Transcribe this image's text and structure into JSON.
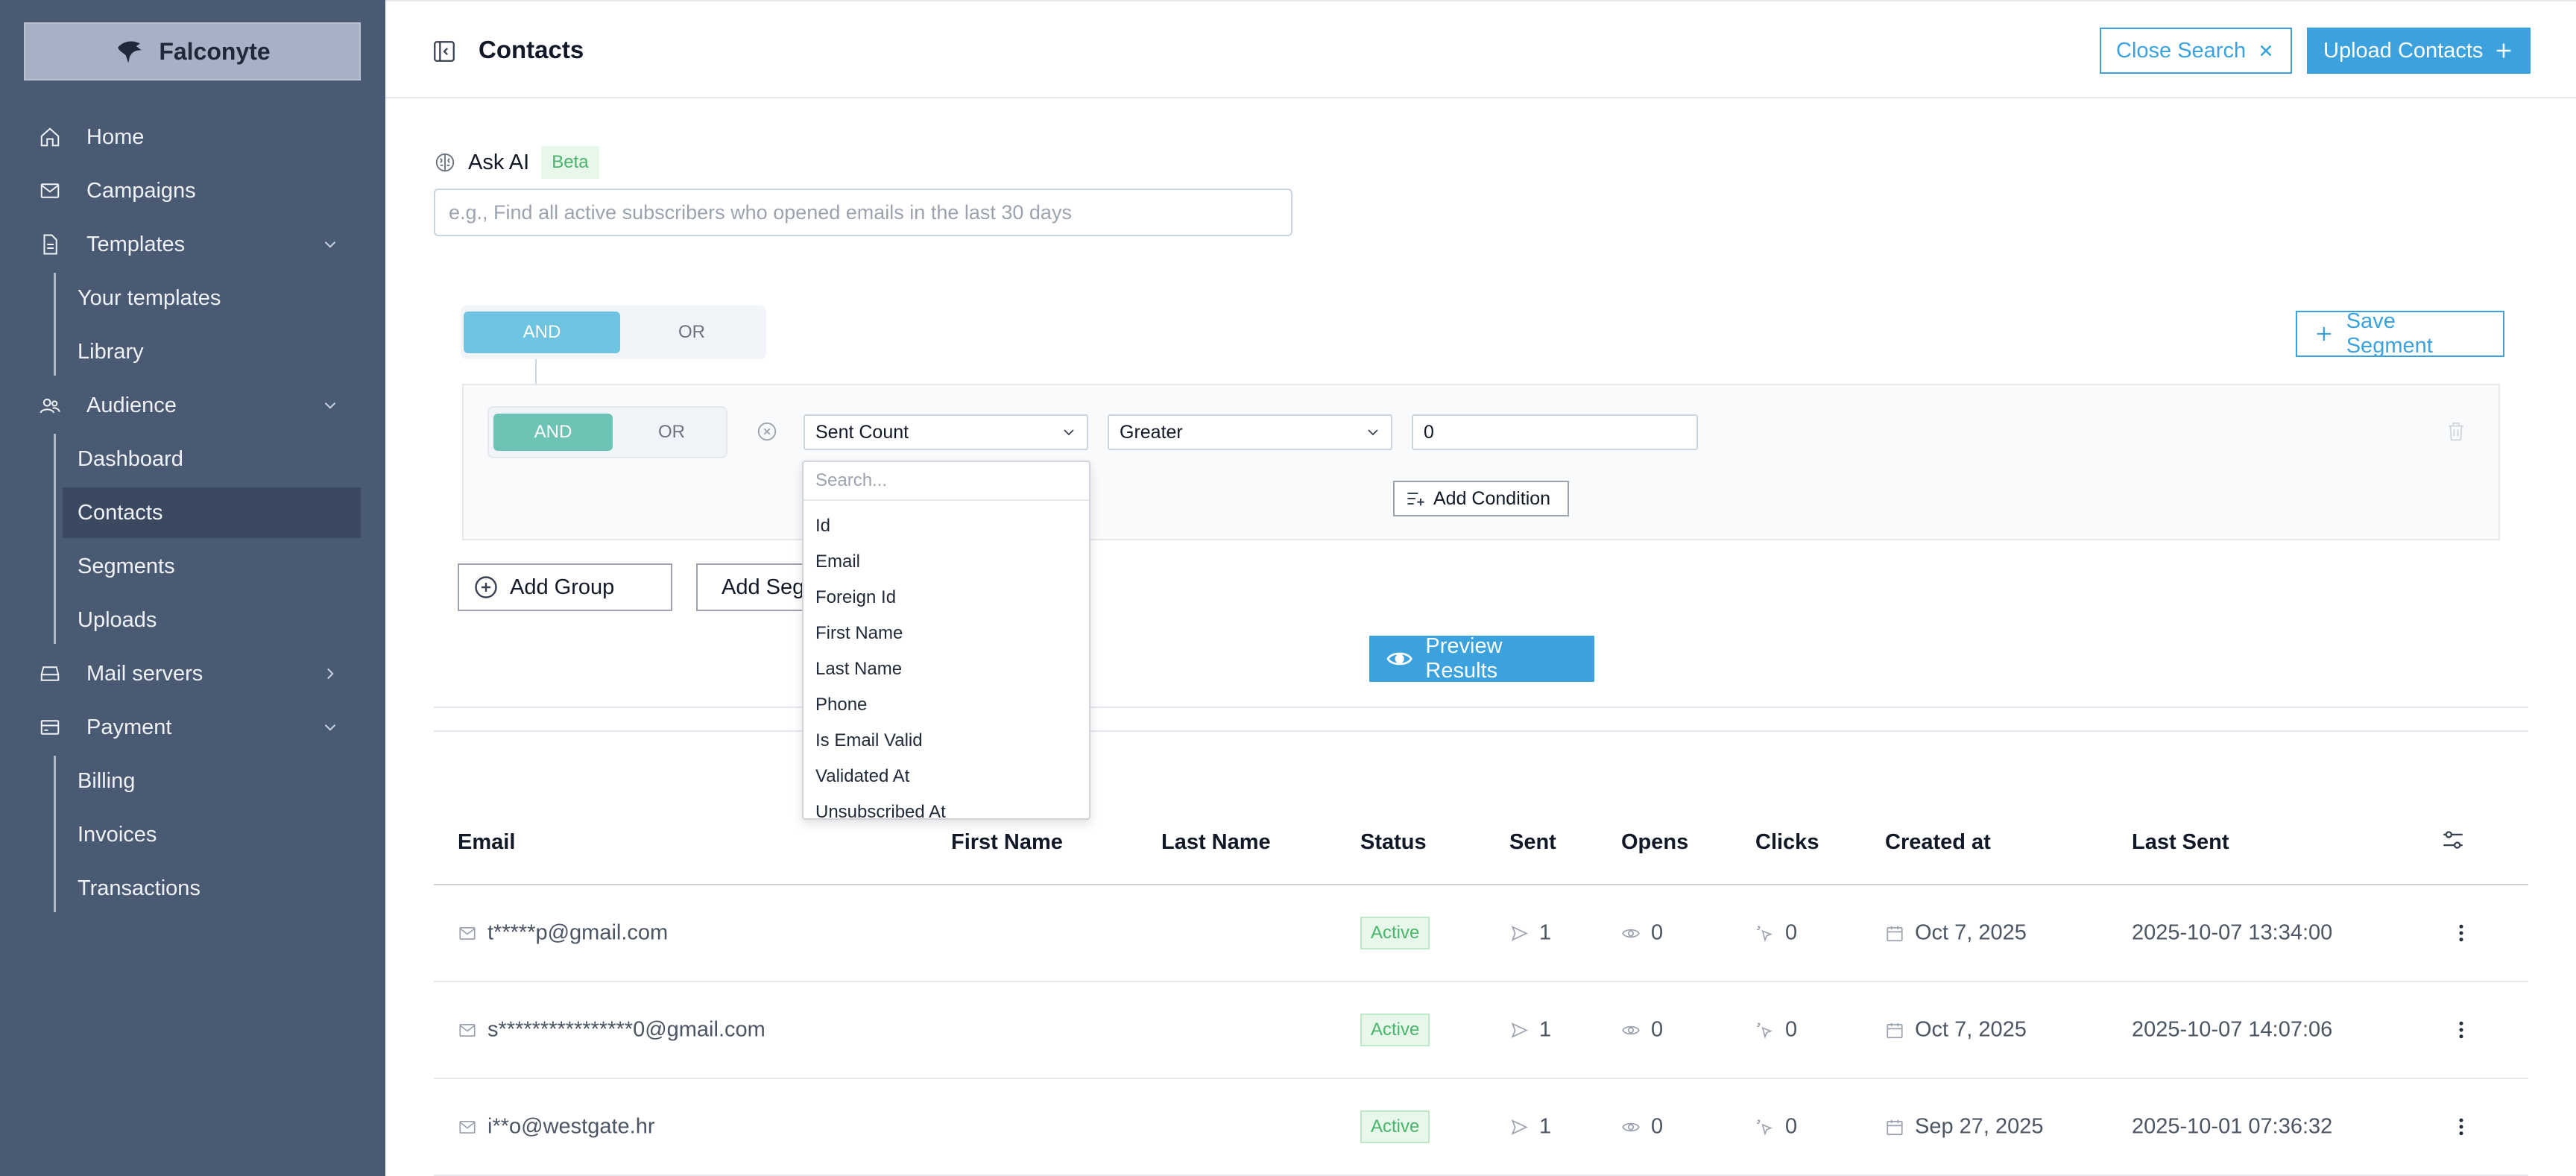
{
  "brand": {
    "name": "Falconyte"
  },
  "sidebar": {
    "items": [
      {
        "label": "Home",
        "icon": "home-icon"
      },
      {
        "label": "Campaigns",
        "icon": "mail-icon"
      },
      {
        "label": "Templates",
        "icon": "file-icon",
        "expanded": true,
        "children": [
          "Your templates",
          "Library"
        ]
      },
      {
        "label": "Audience",
        "icon": "users-icon",
        "expanded": true,
        "children": [
          "Dashboard",
          "Contacts",
          "Segments",
          "Uploads"
        ]
      },
      {
        "label": "Mail servers",
        "icon": "server-icon",
        "expanded": false
      },
      {
        "label": "Payment",
        "icon": "credit-card-icon",
        "expanded": true,
        "children": [
          "Billing",
          "Invoices",
          "Transactions"
        ]
      }
    ],
    "active": "Contacts"
  },
  "header": {
    "title": "Contacts",
    "close_search": "Close Search",
    "upload_contacts": "Upload Contacts"
  },
  "ask_ai": {
    "label": "Ask AI",
    "badge": "Beta",
    "placeholder": "e.g., Find all active subscribers who opened emails in the last 30 days"
  },
  "builder": {
    "outer_and": "AND",
    "outer_or": "OR",
    "inner_and": "AND",
    "inner_or": "OR",
    "field": "Sent Count",
    "operator": "Greater",
    "value": "0",
    "add_condition": "Add Condition",
    "save_segment": "Save Segment",
    "add_group": "Add Group",
    "add_segment": "Add Segment",
    "preview": "Preview Results"
  },
  "dropdown": {
    "search_placeholder": "Search...",
    "options": [
      "Id",
      "Email",
      "Foreign Id",
      "First Name",
      "Last Name",
      "Phone",
      "Is Email Valid",
      "Validated At",
      "Unsubscribed At"
    ]
  },
  "table": {
    "columns": [
      "Email",
      "First Name",
      "Last Name",
      "Status",
      "Sent",
      "Opens",
      "Clicks",
      "Created at",
      "Last Sent"
    ],
    "rows": [
      {
        "email": "t*****p@gmail.com",
        "first": "",
        "last": "",
        "status": "Active",
        "sent": "1",
        "opens": "0",
        "clicks": "0",
        "created": "Oct 7, 2025",
        "last_sent": "2025-10-07 13:34:00"
      },
      {
        "email": "s****************0@gmail.com",
        "first": "",
        "last": "",
        "status": "Active",
        "sent": "1",
        "opens": "0",
        "clicks": "0",
        "created": "Oct 7, 2025",
        "last_sent": "2025-10-07 14:07:06"
      },
      {
        "email": "i**o@westgate.hr",
        "first": "",
        "last": "",
        "status": "Active",
        "sent": "1",
        "opens": "0",
        "clicks": "0",
        "created": "Sep 27, 2025",
        "last_sent": "2025-10-01 07:36:32"
      }
    ]
  },
  "colors": {
    "sidebar": "#4b5a73",
    "accent": "#3ba2de",
    "active_green": "#4ab36c"
  }
}
